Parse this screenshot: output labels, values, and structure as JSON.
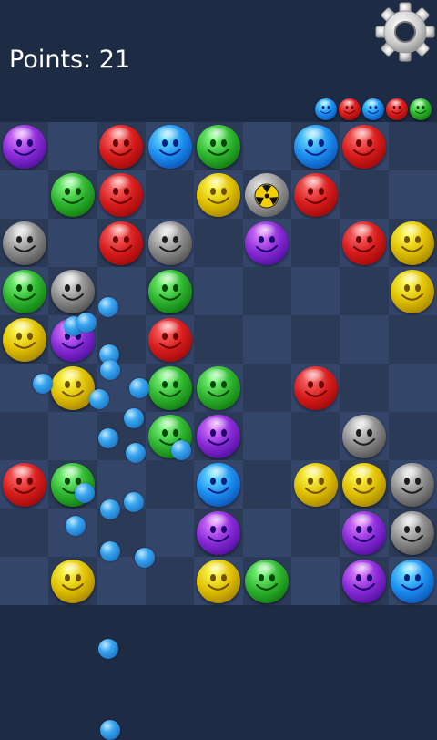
{
  "header": {
    "score_text": "Points: 21",
    "settings_icon": "gear-icon"
  },
  "colors": {
    "purple": "#8a2bd8",
    "red": "#d81c1c",
    "blue": "#1d8ff0",
    "green": "#2fb52f",
    "yellow": "#e0c000",
    "gray": "#8b8b8b",
    "bomb": "radioactive-icon"
  },
  "next_balls": [
    "blue",
    "red",
    "blue",
    "red",
    "green"
  ],
  "board": {
    "cols": 9,
    "rows": 10,
    "grid": [
      [
        "purple",
        "",
        "red",
        "blue",
        "green",
        "",
        "blue",
        "red",
        ""
      ],
      [
        "",
        "green",
        "red",
        "",
        "yellow",
        "bomb",
        "red",
        "",
        ""
      ],
      [
        "gray",
        "",
        "red",
        "gray",
        "",
        "purple",
        "",
        "red",
        "yellow"
      ],
      [
        "green",
        "gray",
        "",
        "green",
        "",
        "",
        "",
        "",
        "yellow"
      ],
      [
        "yellow",
        "purple",
        "",
        "red",
        "",
        "",
        "",
        "",
        ""
      ],
      [
        "",
        "yellow",
        "",
        "green",
        "green",
        "",
        "red",
        "",
        ""
      ],
      [
        "",
        "",
        "",
        "green",
        "purple",
        "",
        "",
        "gray",
        ""
      ],
      [
        "red",
        "green",
        "",
        "",
        "blue",
        "",
        "yellow",
        "yellow",
        "gray"
      ],
      [
        "",
        "",
        "",
        "",
        "purple",
        "",
        "",
        "purple",
        "gray"
      ],
      [
        "",
        "yellow",
        "",
        "",
        "yellow",
        "green",
        "",
        "purple",
        "blue"
      ]
    ]
  }
}
